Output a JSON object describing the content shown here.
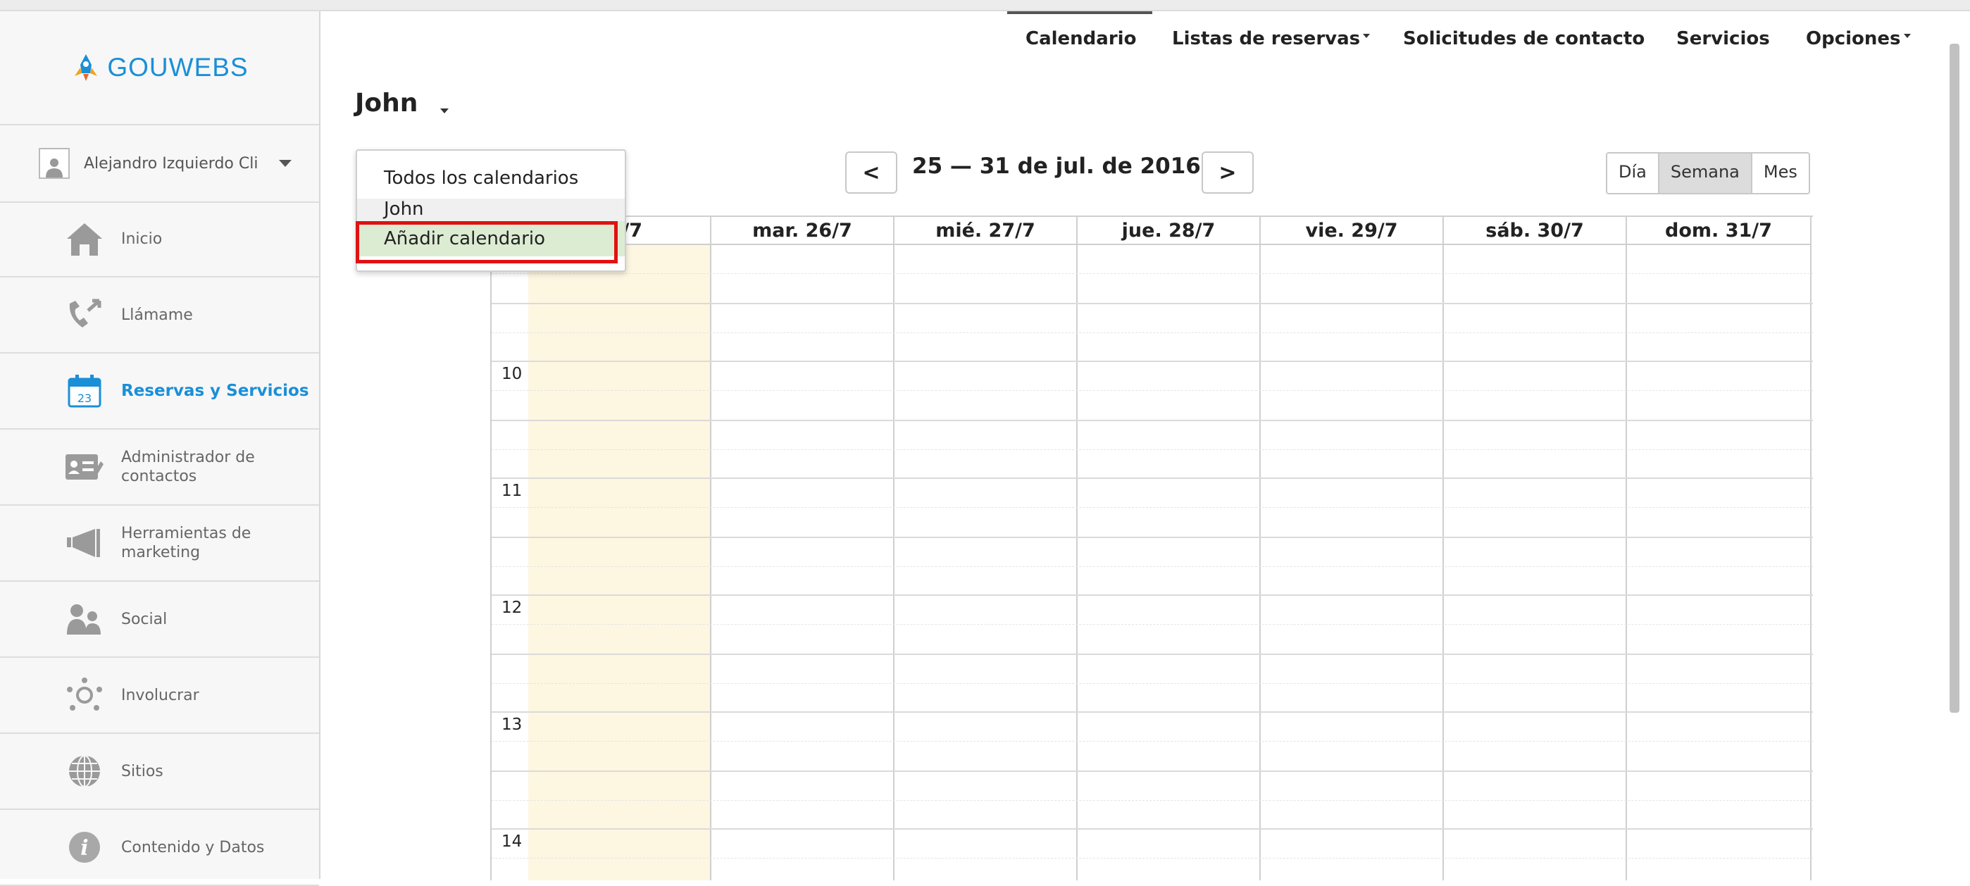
{
  "brand": {
    "logo_text": "GOUWEBS"
  },
  "user": {
    "name": "Alejandro Izquierdo Cli"
  },
  "sidebar": {
    "items": [
      {
        "label": "Inicio",
        "icon": "home-icon"
      },
      {
        "label": "Llámame",
        "icon": "phone-icon"
      },
      {
        "label": "Reservas y Servicios",
        "icon": "calendar-icon",
        "active": true
      },
      {
        "label": "Administrador de contactos",
        "icon": "contact-card-icon"
      },
      {
        "label": "Herramientas de marketing",
        "icon": "megaphone-icon"
      },
      {
        "label": "Social",
        "icon": "people-icon"
      },
      {
        "label": "Involucrar",
        "icon": "network-icon"
      },
      {
        "label": "Sitios",
        "icon": "globe-icon"
      },
      {
        "label": "Contenido y Datos",
        "icon": "info-icon"
      }
    ],
    "calendar_icon_day": "23"
  },
  "topnav": {
    "calendario": "Calendario",
    "listas": "Listas de reservas",
    "solicitudes": "Solicitudes de contacto",
    "servicios": "Servicios",
    "opciones": "Opciones"
  },
  "calendar": {
    "title": "John",
    "date_range": "25 — 31 de jul. de 2016",
    "prev": "<",
    "next": ">",
    "views": [
      "Día",
      "Semana",
      "Mes"
    ],
    "selected_view": "Semana",
    "days": [
      "25/7",
      "mar. 26/7",
      "mié. 27/7",
      "jue. 28/7",
      "vie. 29/7",
      "sáb. 30/7",
      "dom. 31/7"
    ],
    "hours": [
      "10",
      "11",
      "12",
      "13",
      "14"
    ]
  },
  "dropdown": {
    "items": [
      "Todos los calendarios",
      "John",
      "Añadir calendario"
    ],
    "highlighted": "Añadir calendario"
  },
  "colors": {
    "accent": "#1a8fd8",
    "today_column": "#fdf6e1",
    "highlight_border": "#e01212",
    "add_item_bg": "#dcecd3"
  }
}
